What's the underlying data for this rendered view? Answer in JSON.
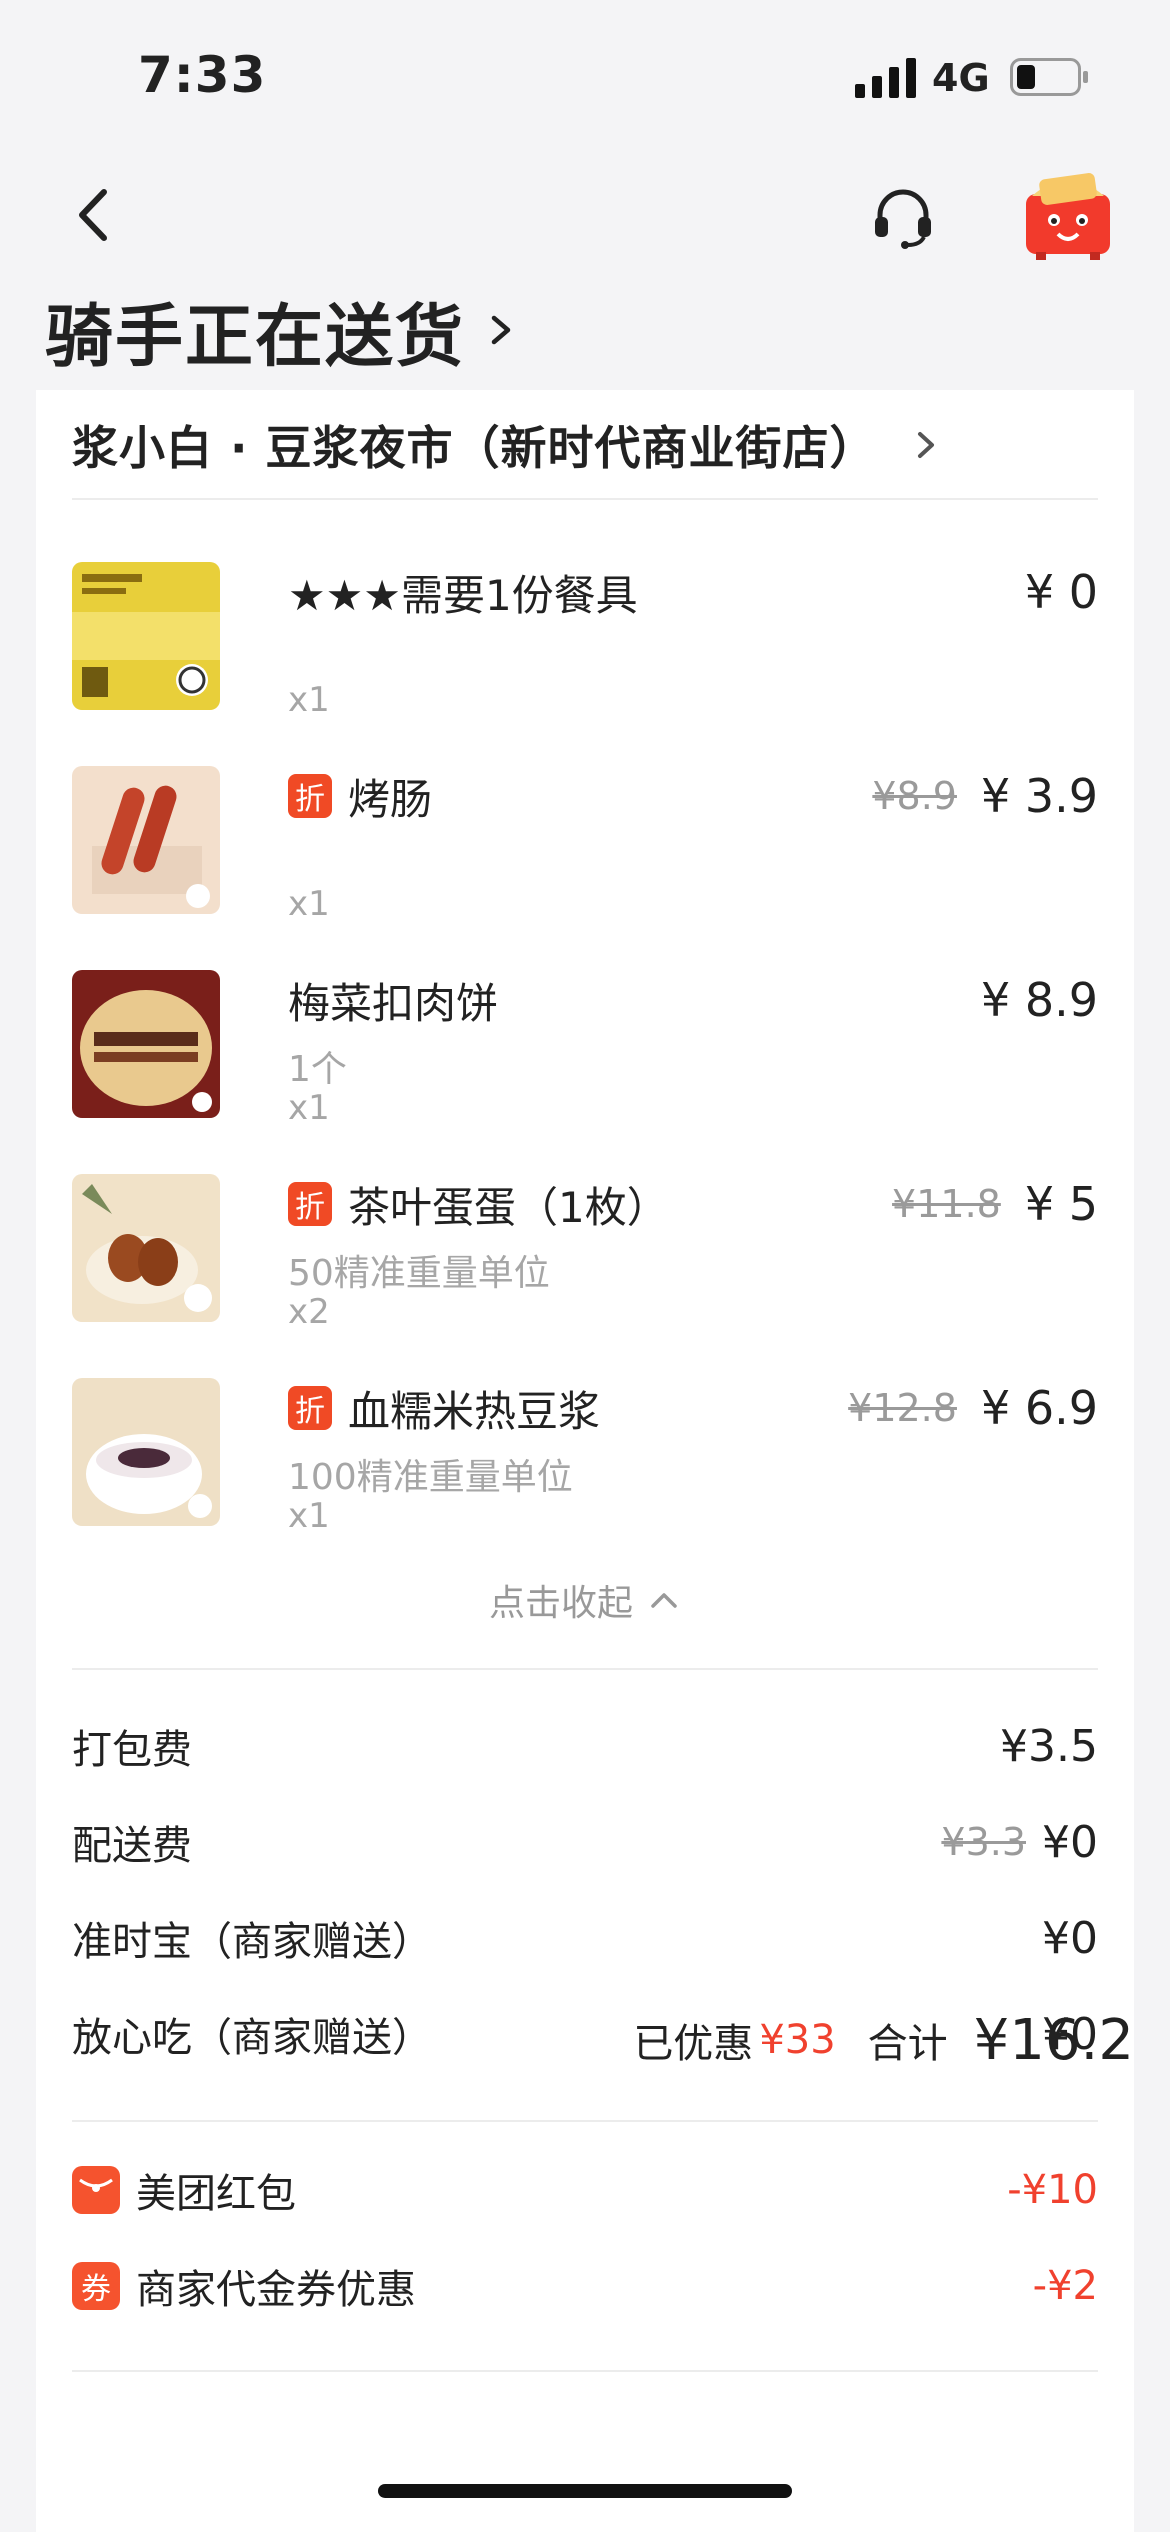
{
  "status_bar": {
    "time": "7:33",
    "network": "4G"
  },
  "page_title": "骑手正在送货",
  "store": {
    "name": "浆小白 · 豆浆夜市（新时代商业街店）"
  },
  "items": [
    {
      "name": "★★★需要1份餐具",
      "discount_badge": "",
      "subtitle": "",
      "qty": "x1",
      "original_price": "",
      "price": "¥ 0"
    },
    {
      "name": "烤肠",
      "discount_badge": "折",
      "subtitle": "",
      "qty": "x1",
      "original_price": "¥8.9",
      "price": "¥ 3.9"
    },
    {
      "name": "梅菜扣肉饼",
      "discount_badge": "",
      "subtitle": "1个",
      "qty": "x1",
      "original_price": "",
      "price": "¥ 8.9"
    },
    {
      "name": "茶叶蛋蛋（1枚）",
      "discount_badge": "折",
      "subtitle": "50精准重量单位",
      "qty": "x2",
      "original_price": "¥11.8",
      "price": "¥ 5"
    },
    {
      "name": "血糯米热豆浆",
      "discount_badge": "折",
      "subtitle": "100精准重量单位",
      "qty": "x1",
      "original_price": "¥12.8",
      "price": "¥ 6.9"
    }
  ],
  "collapse_label": "点击收起",
  "fees": [
    {
      "label": "打包费",
      "original": "",
      "value": "¥3.5"
    },
    {
      "label": "配送费",
      "original": "¥3.3",
      "value": "¥0"
    },
    {
      "label": "准时宝（商家赠送）",
      "original": "",
      "value": "¥0"
    },
    {
      "label": "放心吃（商家赠送）",
      "original": "",
      "value": "¥0"
    }
  ],
  "promos": [
    {
      "label": "美团红包",
      "icon": "red-packet-icon",
      "icon_text": "",
      "value": "-¥10"
    },
    {
      "label": "商家代金券优惠",
      "icon": "coupon-icon",
      "icon_text": "券",
      "value": "-¥2"
    }
  ],
  "summary": {
    "saved_label": "已优惠",
    "saved_value": "¥33",
    "total_label": "合计",
    "total_value": "¥16.2"
  },
  "colors": {
    "accent_red": "#f0412e",
    "badge_orange": "#f04a25"
  }
}
